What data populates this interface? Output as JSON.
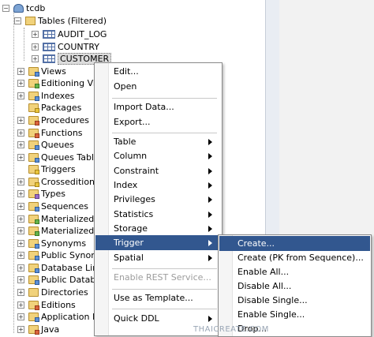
{
  "tree": {
    "db": "tcdb",
    "tables_filtered": "Tables (Filtered)",
    "tables": [
      "AUDIT_LOG",
      "COUNTRY",
      "CUSTOMER"
    ],
    "nodes": [
      "Views",
      "Editioning View",
      "Indexes",
      "Packages",
      "Procedures",
      "Functions",
      "Queues",
      "Queues Tables",
      "Triggers",
      "Crossedition T",
      "Types",
      "Sequences",
      "Materialized Vi",
      "Materialized Vi",
      "Synonyms",
      "Public Synonyr",
      "Database Link",
      "Public Databas",
      "Directories",
      "Editions",
      "Application Ex",
      "Java"
    ]
  },
  "context_menu": {
    "items": [
      "Edit...",
      "Open",
      "Import Data...",
      "Export...",
      "Table",
      "Column",
      "Constraint",
      "Index",
      "Privileges",
      "Statistics",
      "Storage",
      "Trigger",
      "Spatial",
      "Enable REST Service...",
      "Use as Template...",
      "Quick DDL"
    ]
  },
  "trigger_submenu": {
    "items": [
      "Create...",
      "Create (PK from Sequence)...",
      "Enable All...",
      "Disable All...",
      "Disable Single...",
      "Enable Single...",
      "Drop..."
    ]
  },
  "watermark": "THAICREATE.COM"
}
